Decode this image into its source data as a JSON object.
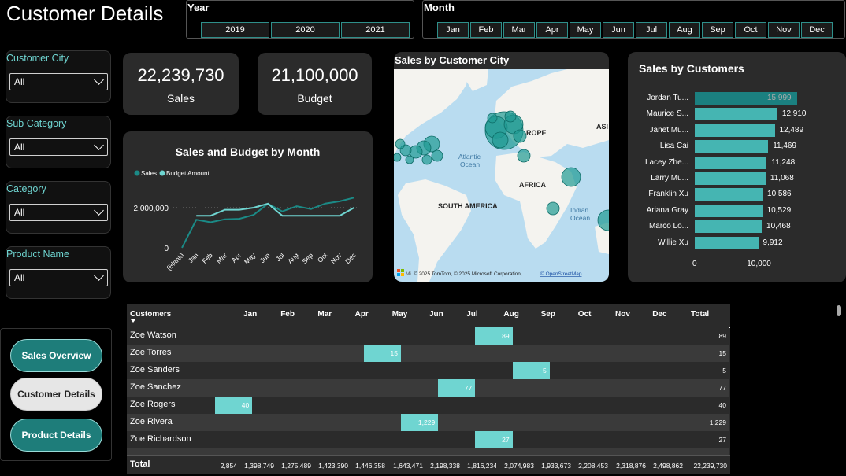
{
  "page_title": "Customer Details",
  "colors": {
    "accent": "#6fd5d1",
    "accent_dark": "#1b8080",
    "card": "#2b2b2b"
  },
  "year_slicer": {
    "title": "Year",
    "options": [
      "2019",
      "2020",
      "2021"
    ]
  },
  "month_slicer": {
    "title": "Month",
    "options": [
      "Jan",
      "Feb",
      "Mar",
      "Apr",
      "May",
      "Jun",
      "Jul",
      "Aug",
      "Sep",
      "Oct",
      "Nov",
      "Dec"
    ]
  },
  "filters": [
    {
      "label": "Customer City",
      "value": "All"
    },
    {
      "label": "Sub Category",
      "value": "All"
    },
    {
      "label": "Category",
      "value": "All"
    },
    {
      "label": "Product Name",
      "value": "All"
    }
  ],
  "kpis": {
    "sales": {
      "value": "22,239,730",
      "label": "Sales"
    },
    "budget": {
      "value": "21,100,000",
      "label": "Budget"
    }
  },
  "nav": {
    "sales_overview": "Sales Overview",
    "customer_details": "Customer Details",
    "product_details": "Product Details"
  },
  "map": {
    "title": "Sales by Customer City",
    "labels": {
      "europe": "ROPE",
      "asia": "ASI",
      "atlantic": "Atlantic\nOcean",
      "africa": "AFRICA",
      "south_america": "SOUTH AMERICA",
      "indian": "Indian\nOcean"
    },
    "atlantic_1": "Atlantic",
    "atlantic_2": "Ocean",
    "indian_1": "Indian",
    "indian_2": "Ocean",
    "attribution": "© 2025 TomTom, © 2025 Microsoft Corporation,",
    "attribution_link": "© OpenStreetMap",
    "ms_label": "Mi"
  },
  "line_chart": {
    "title": "Sales and Budget by Month",
    "legend": [
      "Sales",
      "Budget Amount"
    ],
    "y_ticks": [
      "2,000,000",
      "0"
    ],
    "x_labels": [
      "(Blank)",
      "Jan",
      "Feb",
      "Mar",
      "Apr",
      "May",
      "Jun",
      "Jul",
      "Aug",
      "Sep",
      "Oct",
      "Nov",
      "Dec"
    ]
  },
  "bar_chart_title": "Sales by Customers",
  "table": {
    "col_customers": "Customers",
    "months": [
      "Jan",
      "Feb",
      "Mar",
      "Apr",
      "May",
      "Jun",
      "Jul",
      "Aug",
      "Sep",
      "Oct",
      "Nov",
      "Dec"
    ],
    "col_total": "Total",
    "rows": [
      {
        "name": "Zoe Watson",
        "month_idx": 7,
        "value": "89",
        "total": "89"
      },
      {
        "name": "Zoe Torres",
        "month_idx": 4,
        "value": "15",
        "total": "15"
      },
      {
        "name": "Zoe Sanders",
        "month_idx": 8,
        "value": "5",
        "total": "5"
      },
      {
        "name": "Zoe Sanchez",
        "month_idx": 6,
        "value": "77",
        "total": "77"
      },
      {
        "name": "Zoe Rogers",
        "month_idx": 0,
        "value": "40",
        "total": "40"
      },
      {
        "name": "Zoe Rivera",
        "month_idx": 5,
        "value": "1,229",
        "total": "1,229"
      },
      {
        "name": "Zoe Richardson",
        "month_idx": 7,
        "value": "27",
        "total": "27"
      }
    ],
    "footer_label": "Total",
    "footer_values": [
      "2,854",
      "1,398,749",
      "1,275,489",
      "1,423,390",
      "1,446,358",
      "1,643,471",
      "2,198,338",
      "1,816,234",
      "2,074,983",
      "1,933,673",
      "2,208,453",
      "2,318,876",
      "2,498,862",
      "22,239,730"
    ]
  },
  "chart_data": [
    {
      "type": "line",
      "title": "Sales and Budget by Month",
      "categories": [
        "(Blank)",
        "Jan",
        "Feb",
        "Mar",
        "Apr",
        "May",
        "Jun",
        "Jul",
        "Aug",
        "Sep",
        "Oct",
        "Nov",
        "Dec"
      ],
      "series": [
        {
          "name": "Sales",
          "values": [
            2854,
            1398749,
            1275489,
            1423390,
            1446358,
            1643471,
            2198338,
            1816234,
            2074983,
            1933673,
            2208453,
            2318876,
            2498862
          ]
        },
        {
          "name": "Budget Amount",
          "values": [
            null,
            1600000,
            1600000,
            1900000,
            1900000,
            2000000,
            2200000,
            1600000,
            1600000,
            1600000,
            1600000,
            1600000,
            2000000
          ]
        }
      ],
      "y_ticks": [
        0,
        2000000
      ],
      "ylim": [
        0,
        2600000
      ],
      "legend": "top-left"
    },
    {
      "type": "bar",
      "orientation": "horizontal",
      "title": "Sales by Customers",
      "categories": [
        "Jordan Tu...",
        "Maurice S...",
        "Janet Mu...",
        "Lisa Cai",
        "Lacey Zhe...",
        "Larry Mu...",
        "Franklin Xu",
        "Ariana Gray",
        "Marco Lo...",
        "Willie Xu"
      ],
      "values": [
        15999,
        12910,
        12489,
        11469,
        11248,
        11068,
        10586,
        10529,
        10468,
        9912
      ],
      "value_labels": [
        "15,999",
        "12,910",
        "12,489",
        "11,469",
        "11,248",
        "11,068",
        "10,586",
        "10,529",
        "10,468",
        "9,912"
      ],
      "x_ticks": [
        "0",
        "10,000"
      ],
      "xlim": [
        0,
        17000
      ]
    }
  ]
}
